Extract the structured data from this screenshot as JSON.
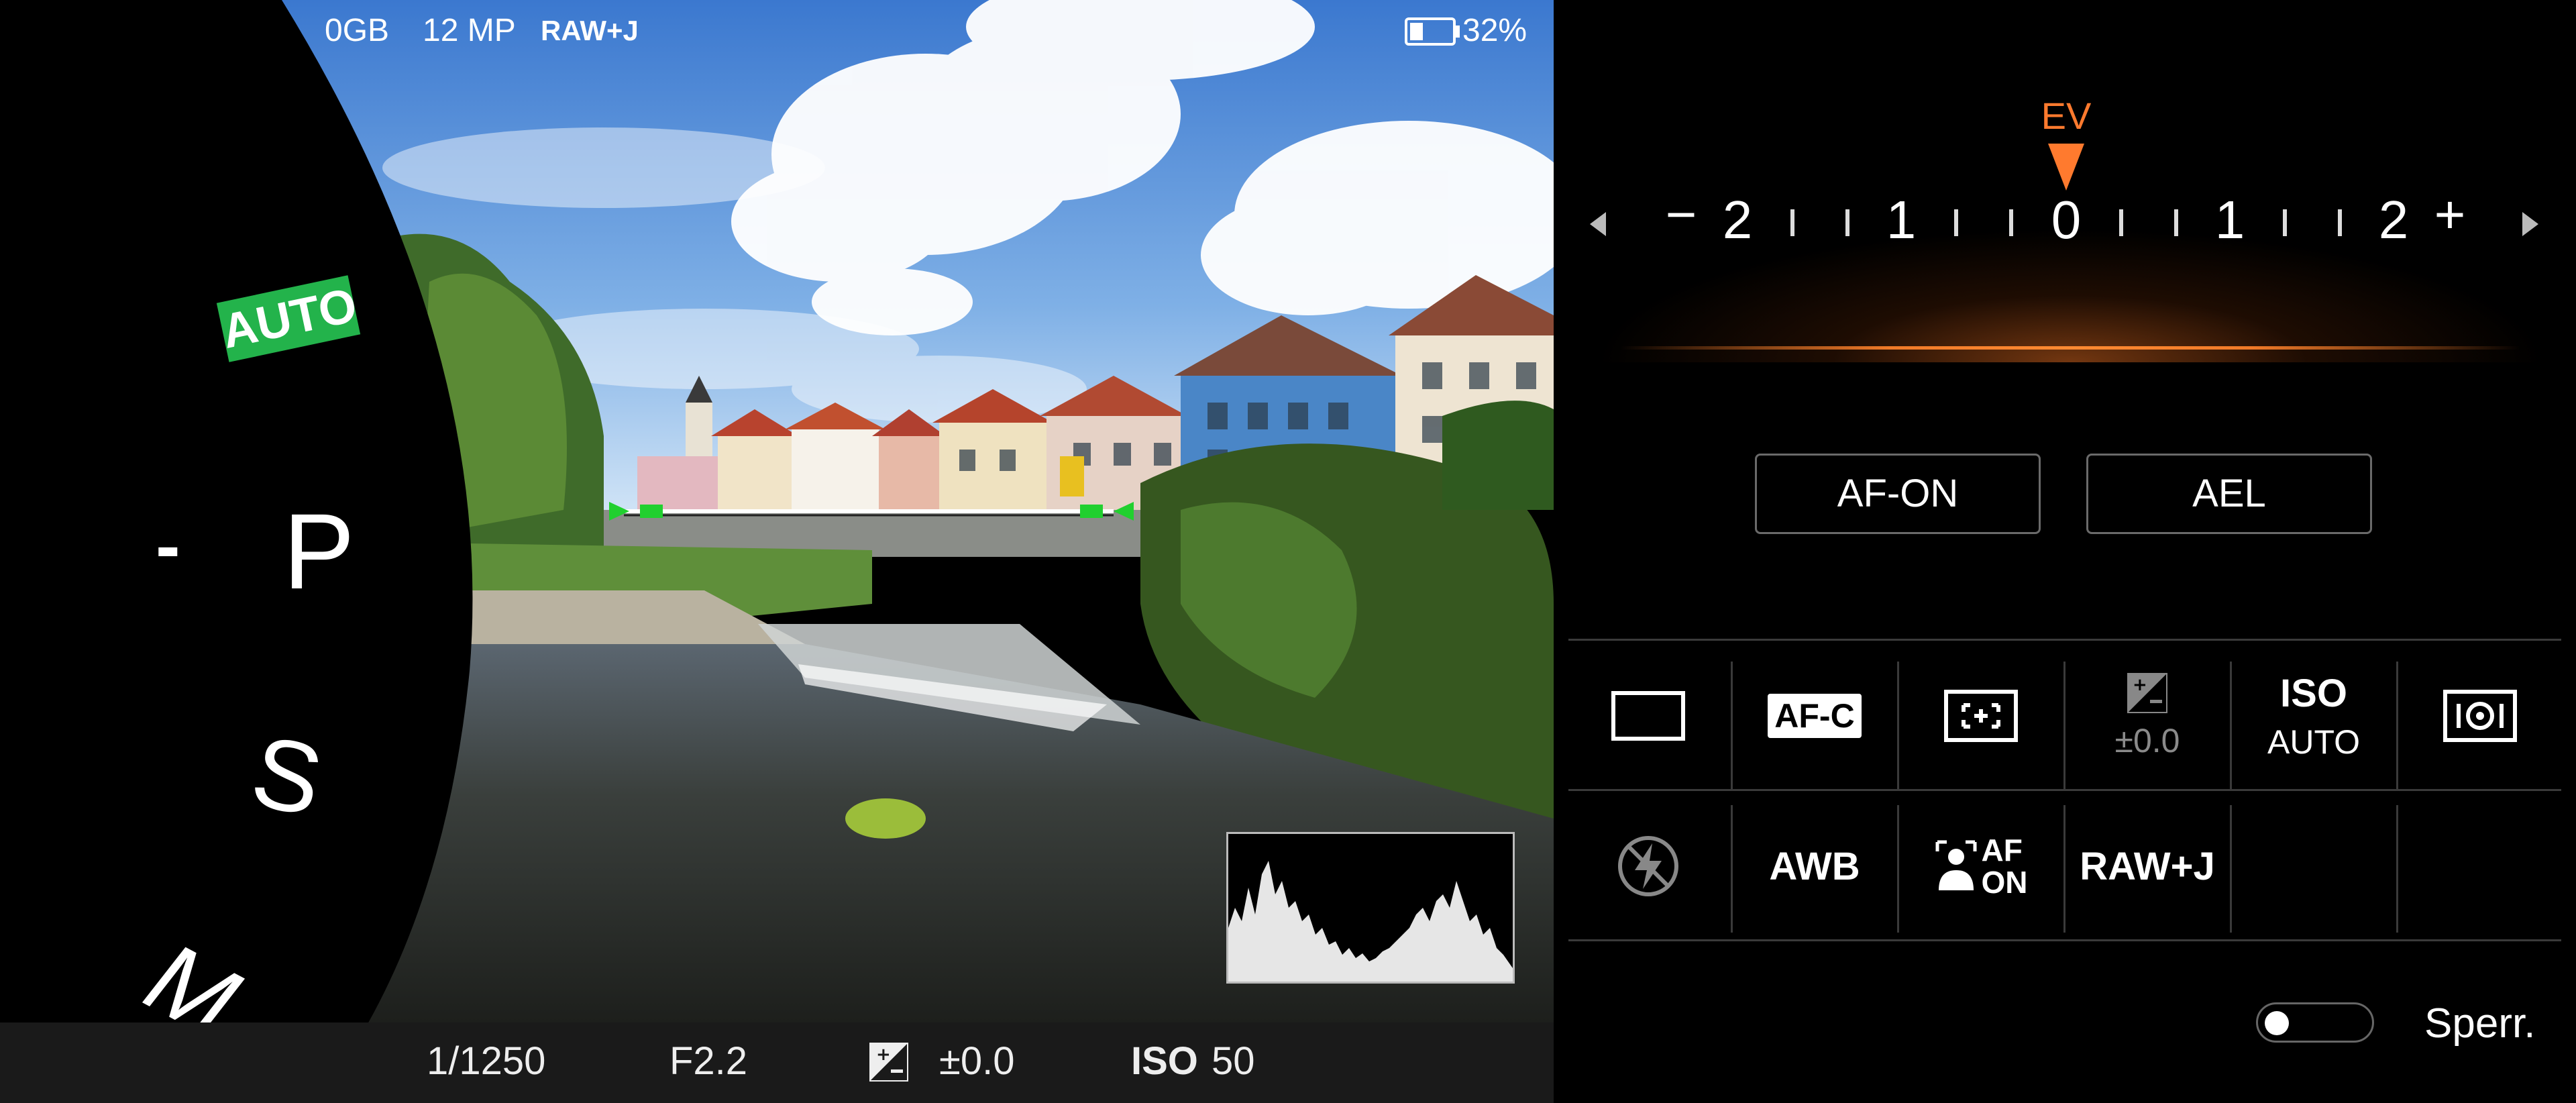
{
  "status_bar": {
    "storage": "0GB",
    "megapixels": "12 MP",
    "file_format": "RAW+J",
    "battery": "32%",
    "battery_level": 0.32
  },
  "mode_dial": {
    "auto": "AUTO",
    "dash": "-",
    "p": "P",
    "s": "S",
    "m": "M",
    "selected": "P"
  },
  "exposure_readout": {
    "shutter": "1/1250",
    "aperture": "F2.2",
    "exposure_comp": "±0.0",
    "iso_label": "ISO",
    "iso_value": "50"
  },
  "ev_scale": {
    "label": "EV",
    "minus": "−",
    "plus": "+",
    "numbers": [
      "2",
      "1",
      "0",
      "1",
      "2"
    ],
    "value": 0.0
  },
  "buttons": {
    "af_on": "AF-ON",
    "ael": "AEL"
  },
  "quick_settings": {
    "af_mode": "AF-C",
    "exposure_comp_value": "±0.0",
    "iso_label": "ISO",
    "iso_value": "AUTO",
    "white_balance": "AWB",
    "face_af_top": "AF",
    "face_af_bottom": "ON",
    "file_format": "RAW+J"
  },
  "lock": {
    "label": "Sperr.",
    "enabled": false
  },
  "colors": {
    "accent_orange": "#ff7a2e",
    "auto_green": "#23b34b",
    "focus_green": "#21d02f"
  },
  "icons": {
    "battery": "battery-icon",
    "exposure_comp": "exposure-comp-icon",
    "drive_single": "single-shot-icon",
    "focus_area": "focus-area-icon",
    "metering": "metering-icon",
    "flash_off": "flash-off-icon",
    "face_eye_af": "face-eye-af-icon"
  }
}
